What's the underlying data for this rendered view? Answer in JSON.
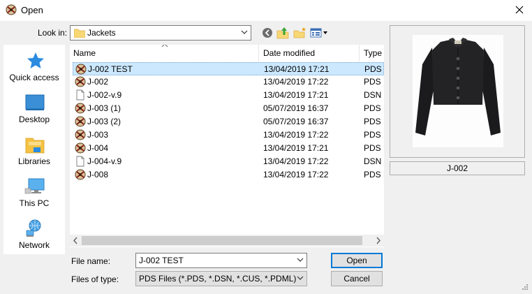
{
  "window": {
    "title": "Open",
    "app_icon": "pds-app-icon",
    "close_icon": "close-icon"
  },
  "look_in": {
    "label": "Look in:",
    "value": "Jackets",
    "folder_icon": "folder-icon"
  },
  "toolbar": {
    "items": [
      "back-icon",
      "up-folder-icon",
      "new-folder-icon",
      "view-menu-icon"
    ]
  },
  "places": [
    {
      "label": "Quick access",
      "icon": "star-icon"
    },
    {
      "label": "Desktop",
      "icon": "desktop-icon"
    },
    {
      "label": "Libraries",
      "icon": "libraries-icon"
    },
    {
      "label": "This PC",
      "icon": "computer-icon"
    },
    {
      "label": "Network",
      "icon": "network-icon"
    }
  ],
  "file_list": {
    "columns": {
      "name": "Name",
      "date": "Date modified",
      "type": "Type"
    },
    "rows": [
      {
        "name": "J-002 TEST",
        "date": "13/04/2019 17:21",
        "type": "PDS F",
        "icon": "pds-file-icon",
        "selected": true
      },
      {
        "name": "J-002",
        "date": "13/04/2019 17:22",
        "type": "PDS F",
        "icon": "pds-file-icon"
      },
      {
        "name": "J-002-v.9",
        "date": "13/04/2019 17:21",
        "type": "DSN I",
        "icon": "document-icon"
      },
      {
        "name": "J-003 (1)",
        "date": "05/07/2019 16:37",
        "type": "PDS F",
        "icon": "pds-file-icon"
      },
      {
        "name": "J-003 (2)",
        "date": "05/07/2019 16:37",
        "type": "PDS F",
        "icon": "pds-file-icon"
      },
      {
        "name": "J-003",
        "date": "13/04/2019 17:22",
        "type": "PDS F",
        "icon": "pds-file-icon"
      },
      {
        "name": "J-004",
        "date": "13/04/2019 17:21",
        "type": "PDS F",
        "icon": "pds-file-icon"
      },
      {
        "name": "J-004-v.9",
        "date": "13/04/2019 17:22",
        "type": "DSN I",
        "icon": "document-icon"
      },
      {
        "name": "J-008",
        "date": "13/04/2019 17:22",
        "type": "PDS F",
        "icon": "pds-file-icon"
      }
    ]
  },
  "preview": {
    "caption": "J-002",
    "image": "jacket-preview-image"
  },
  "file_name": {
    "label": "File name:",
    "value": "J-002 TEST"
  },
  "file_type": {
    "label": "Files of type:",
    "value": "PDS Files (*.PDS, *.DSN, *.CUS, *.PDML)"
  },
  "buttons": {
    "open": "Open",
    "cancel": "Cancel"
  },
  "colors": {
    "selection": "#cce8ff",
    "accent": "#0078d7",
    "background": "#f0f0f0"
  }
}
